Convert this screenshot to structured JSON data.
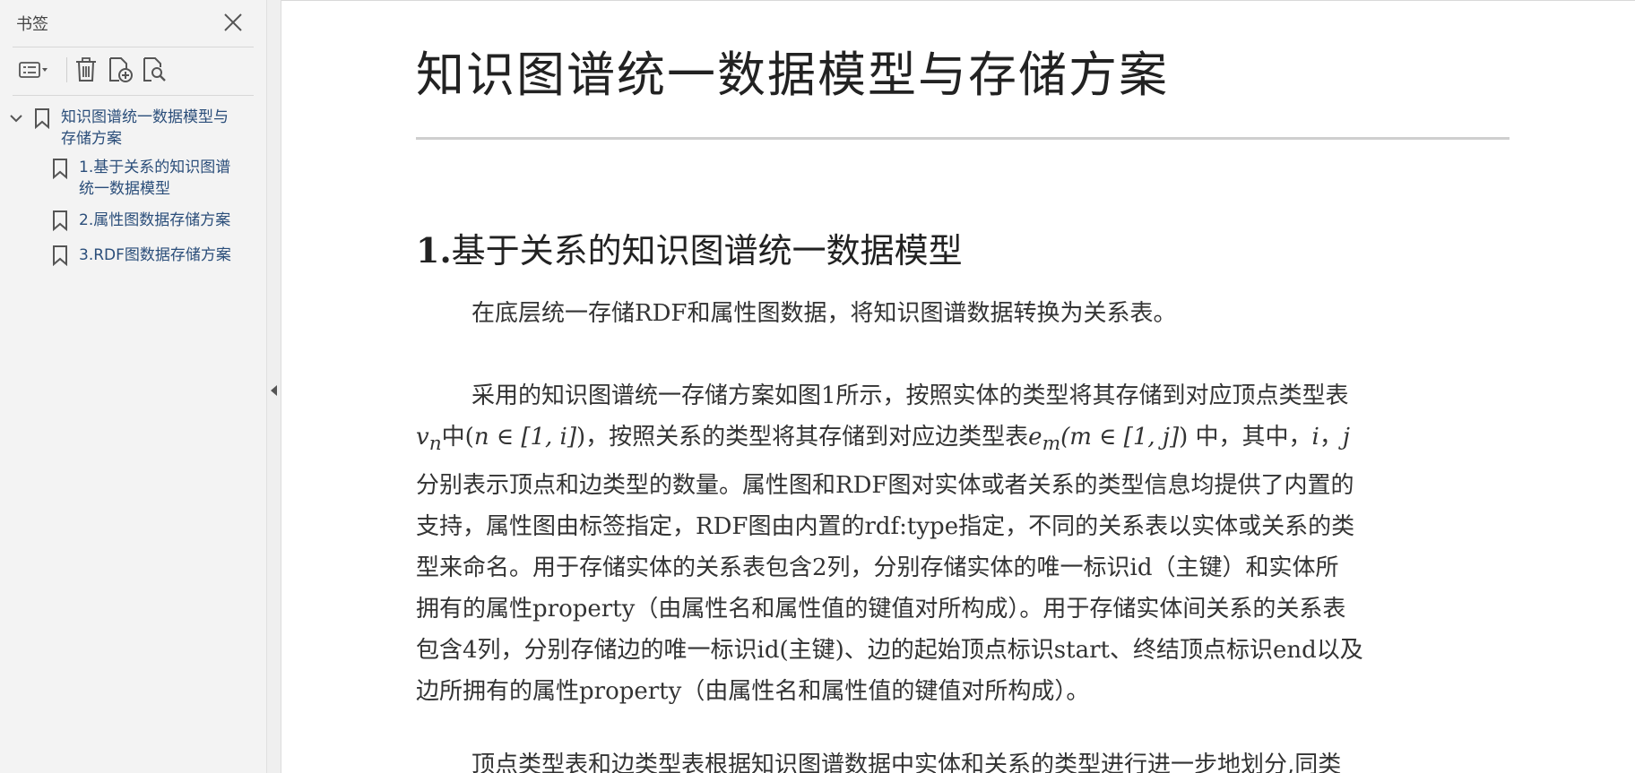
{
  "sidebar": {
    "title": "书签",
    "toolbar": {
      "options": "list-options-icon",
      "delete": "trash-icon",
      "add": "add-bookmark-icon",
      "find": "find-bookmark-icon"
    },
    "bookmarks": [
      {
        "label_line1": "知识图谱统一数据模型与",
        "label_line2": "存储方案",
        "expanded": true
      },
      {
        "label_line1": "1.基于关系的知识图谱",
        "label_line2": "统一数据模型"
      },
      {
        "label_line1": "2.属性图数据存储方案"
      },
      {
        "label_line1": "3.RDF图数据存储方案"
      }
    ]
  },
  "document": {
    "title": "知识图谱统一数据模型与存储方案",
    "section1": {
      "number": "1.",
      "heading": "基于关系的知识图谱统一数据模型"
    },
    "para1": "在底层统一存储RDF和属性图数据，将知识图谱数据转换为关系表。",
    "para2": {
      "l1": "采用的知识图谱统一存储方案如图1所示，按照实体的类型将其存储到对应顶点类型表",
      "l2_a": "v",
      "l2_a_sub": "n",
      "l2_b": "中(",
      "l2_c": "n ∈ [1, i]",
      "l2_d": ")，按照关系的类型将其存储到对应边类型表",
      "l2_e": "e",
      "l2_e_sub": "m",
      "l2_f": "(m ∈ [1, j]",
      "l2_g": ") 中，其中，",
      "l2_h": "i",
      "l2_i": "，",
      "l2_j": "j",
      "l3": "分别表示顶点和边类型的数量。属性图和RDF图对实体或者关系的类型信息均提供了内置的",
      "l4": "支持，属性图由标签指定，RDF图由内置的rdf:type指定，不同的关系表以实体或关系的类",
      "l5": "型来命名。用于存储实体的关系表包含2列，分别存储实体的唯一标识id（主键）和实体所",
      "l6": "拥有的属性property（由属性名和属性值的键值对所构成）。用于存储实体间关系的关系表",
      "l7": "包含4列，分别存储边的唯一标识id(主键)、边的起始顶点标识start、终结顶点标识end以及",
      "l8": "边所拥有的属性property（由属性名和属性值的键值对所构成）。"
    },
    "para3": "顶点类型表和边类型表根据知识图谱数据中实体和关系的类型进行进一步地划分,同类"
  }
}
